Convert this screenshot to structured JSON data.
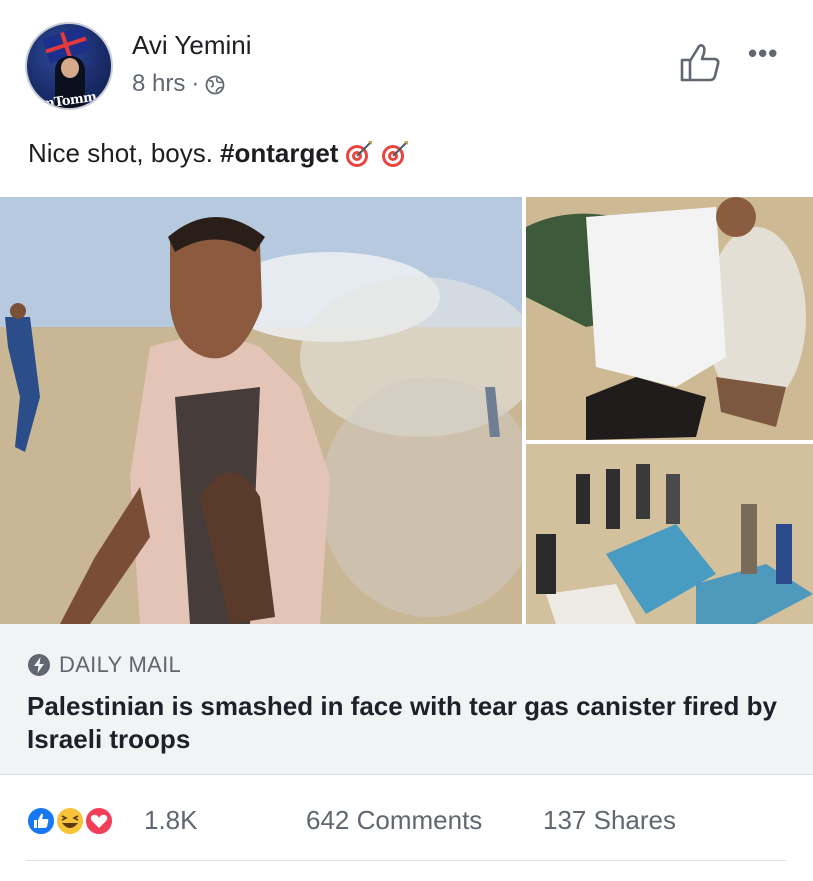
{
  "post": {
    "author": "Avi Yemini",
    "time": "8 hrs",
    "separator": "·",
    "privacy_icon": "globe-icon",
    "avatar_overlay_text": "amTomm",
    "text": "Nice shot, boys.",
    "hashtag": "#ontarget",
    "emojis": [
      "direct-hit-emoji",
      "direct-hit-emoji"
    ]
  },
  "link_preview": {
    "source": "DAILY MAIL",
    "headline": "Palestinian is smashed in face with tear gas canister fired by Israeli troops"
  },
  "stats": {
    "reaction_icons": [
      "like-reaction-icon",
      "haha-reaction-icon",
      "love-reaction-icon"
    ],
    "reaction_count": "1.8K",
    "comments": "642 Comments",
    "shares": "137 Shares"
  },
  "colors": {
    "text_primary": "#1c1e21",
    "text_secondary": "#606770",
    "link_bg": "#f2f3f5",
    "like_blue": "#1877f2",
    "haha_yellow": "#f7c33b",
    "love_red": "#f33e58"
  }
}
